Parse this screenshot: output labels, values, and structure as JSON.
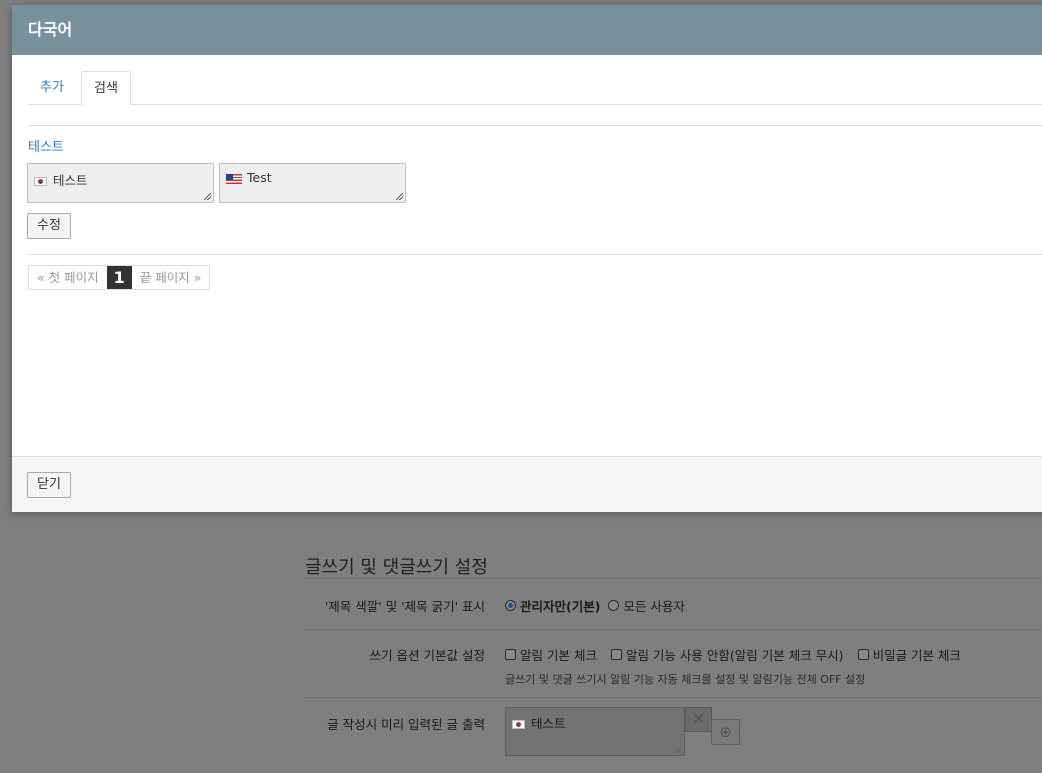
{
  "modal": {
    "title": "다국어",
    "tabs": [
      {
        "label": "추가"
      },
      {
        "label": "검색"
      }
    ],
    "entry": {
      "title": "테스트",
      "translations": [
        {
          "lang_icon": "flag-kr-icon",
          "value": "테스트"
        },
        {
          "lang_icon": "flag-us-icon",
          "value": "Test"
        }
      ],
      "edit_label": "수정"
    },
    "pagination": {
      "first": "« 첫 페이지",
      "current": "1",
      "last": "끝 페이지 »"
    },
    "close_label": "닫기"
  },
  "settings": {
    "section_title": "글쓰기 및 댓글쓰기 설정",
    "rows": [
      {
        "label": "'제목 색깔' 및 '제목 굵기' 표시",
        "options": [
          "관리자만(기본)",
          "모든 사용자"
        ],
        "selected": "관리자만(기본)"
      },
      {
        "label": "쓰기 옵션 기본값 설정",
        "options": [
          "알림 기본 체크",
          "알림 기능 사용 안함(알림 기본 체크 무시)",
          "비밀글 기본 체크"
        ],
        "help": "글쓰기 및 댓글 쓰기시 알림 기능 자동 체크를 설정 및 알림기능 전체 OFF 설정"
      },
      {
        "label": "글 작성시 미리 입력된 글 출력",
        "value": "테스트"
      }
    ]
  },
  "colors": {
    "header_bg": "#78929d",
    "link": "#2a7bc8",
    "overlay": "#7f7f7f"
  }
}
